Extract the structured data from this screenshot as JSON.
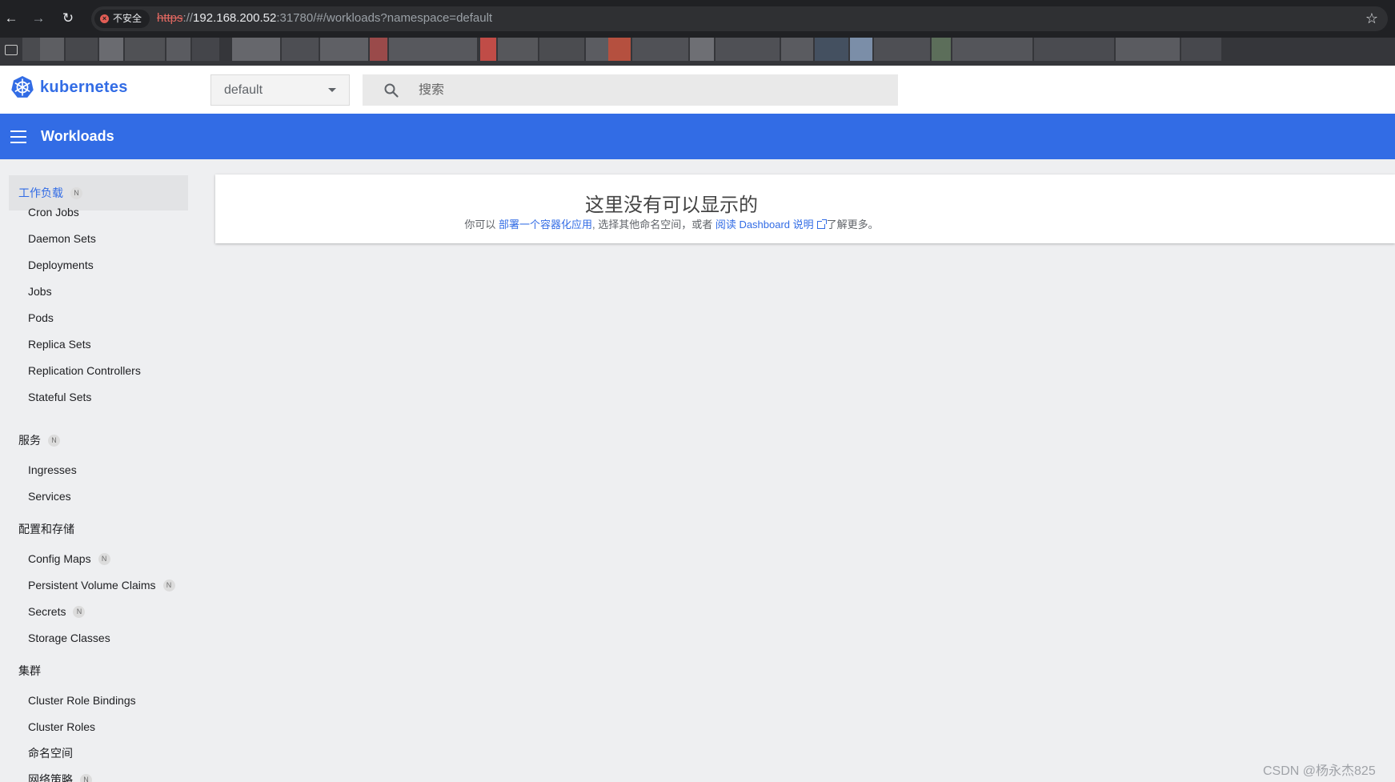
{
  "browser": {
    "security_label": "不安全",
    "url_scheme": "https",
    "url_sep": "://",
    "url_host": "192.168.200.52",
    "url_rest": ":31780/#/workloads?namespace=default",
    "bookmarks_blurred_text": "...WIN...  ..."
  },
  "header": {
    "logo_text": "kubernetes",
    "namespace": "default",
    "search_placeholder": "搜索"
  },
  "toolbar": {
    "title": "Workloads"
  },
  "sidebar": {
    "badge": "N",
    "groups": [
      {
        "label": "工作负载",
        "badge": true,
        "active": true,
        "items": [
          {
            "label": "Cron Jobs"
          },
          {
            "label": "Daemon Sets"
          },
          {
            "label": "Deployments"
          },
          {
            "label": "Jobs"
          },
          {
            "label": "Pods"
          },
          {
            "label": "Replica Sets"
          },
          {
            "label": "Replication Controllers"
          },
          {
            "label": "Stateful Sets"
          }
        ]
      },
      {
        "label": "服务",
        "badge": true,
        "active": false,
        "items": [
          {
            "label": "Ingresses"
          },
          {
            "label": "Services"
          }
        ]
      },
      {
        "label": "配置和存储",
        "badge": false,
        "active": false,
        "items": [
          {
            "label": "Config Maps",
            "badge": true
          },
          {
            "label": "Persistent Volume Claims",
            "badge": true
          },
          {
            "label": "Secrets",
            "badge": true
          },
          {
            "label": "Storage Classes"
          }
        ]
      },
      {
        "label": "集群",
        "badge": false,
        "active": false,
        "items": [
          {
            "label": "Cluster Role Bindings"
          },
          {
            "label": "Cluster Roles"
          },
          {
            "label": "命名空间"
          },
          {
            "label": "网络策略",
            "badge": true
          }
        ]
      }
    ]
  },
  "empty_state": {
    "title": "这里没有可以显示的",
    "prefix": "你可以",
    "deploy_link": "部署一个容器化应用",
    "middle": ", 选择其他命名空间，或者",
    "docs_link": "阅读 Dashboard 说明",
    "suffix": "了解更多。"
  },
  "watermark": "CSDN @杨永杰825",
  "colors": {
    "accent": "#326ce5",
    "toolbar": "#326ce5",
    "background": "#eeeff1"
  }
}
